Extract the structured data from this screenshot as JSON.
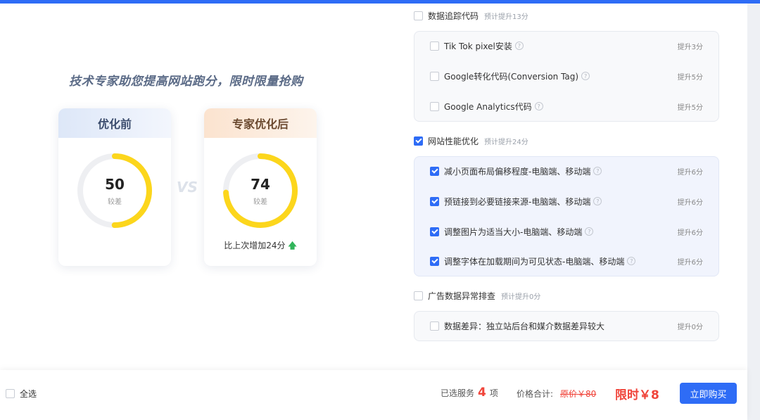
{
  "promo": {
    "title": "技术专家助您提高网站跑分，限时限量抢购",
    "vs": "VS",
    "before": {
      "label": "优化前",
      "score": "50",
      "grade": "较差",
      "score_pct": 50
    },
    "after": {
      "label": "专家优化后",
      "score": "74",
      "grade": "较差",
      "score_pct": 74,
      "increase": "比上次增加24分"
    }
  },
  "groups": [
    {
      "name": "数据追踪代码",
      "gain": "预计提升13分",
      "checked": false,
      "items": [
        {
          "name": "Tik Tok pixel安装",
          "gain": "提升3分",
          "checked": false
        },
        {
          "name": "Google转化代码(Conversion Tag)",
          "gain": "提升5分",
          "checked": false
        },
        {
          "name": "Google Analytics代码",
          "gain": "提升5分",
          "checked": false
        }
      ]
    },
    {
      "name": "网站性能优化",
      "gain": "预计提升24分",
      "checked": true,
      "items": [
        {
          "name": "减小页面布局偏移程度-电脑端、移动端",
          "gain": "提升6分",
          "checked": true
        },
        {
          "name": "预链接到必要链接来源-电脑端、移动端",
          "gain": "提升6分",
          "checked": true
        },
        {
          "name": "调整图片为适当大小-电脑端、移动端",
          "gain": "提升6分",
          "checked": true
        },
        {
          "name": "调整字体在加载期间为可见状态-电脑端、移动端",
          "gain": "提升6分",
          "checked": true
        }
      ]
    },
    {
      "name": "广告数据异常排查",
      "gain": "预计提升0分",
      "checked": false,
      "items": [
        {
          "name": "数据差异：独立站后台和媒介数据差异较大",
          "gain": "提升0分",
          "checked": false
        }
      ]
    }
  ],
  "footer": {
    "select_all": "全选",
    "selected_prefix": "已选服务",
    "selected_count": "4",
    "selected_suffix": "项",
    "price_label": "价格合计:",
    "original_price": "原价￥80",
    "sale_price": "限时￥8",
    "buy_button": "立即购买"
  },
  "colors": {
    "primary": "#2e6cf6",
    "accent_red": "#f0443a",
    "gauge_yellow": "#fcd61c",
    "gauge_track": "#eeeff2"
  }
}
